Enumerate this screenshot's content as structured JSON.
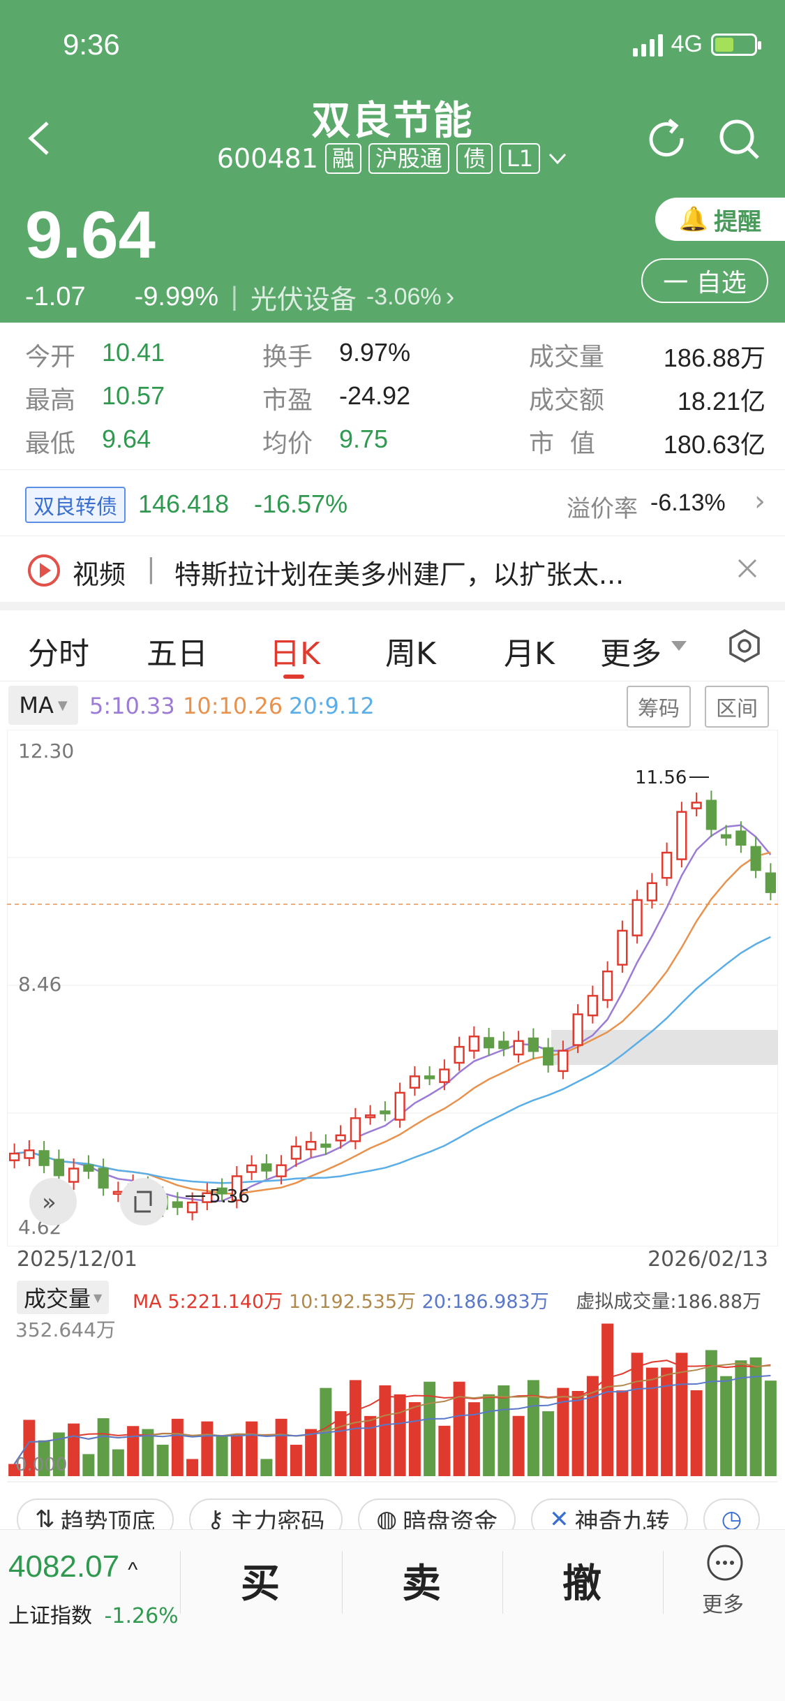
{
  "status": {
    "time": "9:36",
    "network": "4G"
  },
  "stock": {
    "name": "双良节能",
    "code": "600481",
    "tags": [
      "融",
      "沪股通",
      "债",
      "L1"
    ],
    "price": "9.64",
    "change": "-1.07",
    "change_pct": "-9.99%",
    "sector": "光伏设备",
    "sector_pct": "-3.06%",
    "remind": "提醒",
    "watch": "一 自选"
  },
  "stats": {
    "open_label": "今开",
    "open": "10.41",
    "high_label": "最高",
    "high": "10.57",
    "low_label": "最低",
    "low": "9.64",
    "turnover_label": "换手",
    "turnover": "9.97%",
    "pe_label": "市盈",
    "pe": "-24.92",
    "avg_label": "均价",
    "avg": "9.75",
    "vol_label": "成交量",
    "vol": "186.88万",
    "amount_label": "成交额",
    "amount": "18.21亿",
    "cap_label": "市  值",
    "cap": "180.63亿"
  },
  "bond": {
    "tag": "双良转债",
    "price": "146.418",
    "pct": "-16.57%",
    "premium_label": "溢价率",
    "premium": "-6.13%"
  },
  "news": {
    "tag": "视频",
    "text": "特斯拉计划在美多州建厂，以扩张太..."
  },
  "tabs": [
    "分时",
    "五日",
    "日K",
    "周K",
    "月K",
    "更多"
  ],
  "active_tab": "日K",
  "ma": {
    "label": "MA",
    "ma5": "5:10.33",
    "ma10": "10:10.26",
    "ma20": "20:9.12",
    "btn_chips": "筹码",
    "btn_range": "区间"
  },
  "kline": {
    "y_top": "12.30",
    "y_mid": "8.46",
    "y_bottom": "4.62",
    "date_start": "2025/12/01",
    "date_end": "2026/02/13",
    "max_label": "11.56",
    "min_label": "5.36"
  },
  "volume": {
    "label": "成交量",
    "ma_label": "MA",
    "ma5": "5:221.140万",
    "ma10": "10:192.535万",
    "ma20": "20:186.983万",
    "virtual": "虚拟成交量:186.88万",
    "top": "352.644万",
    "bottom": "0.000"
  },
  "chips": [
    "趋势顶底",
    "主力密码",
    "暗盘资金",
    "神奇九转"
  ],
  "bottom": {
    "index_value": "4082.07",
    "index_name": "上证指数",
    "index_pct": "-1.26%",
    "buy": "买",
    "sell": "卖",
    "cancel": "撤",
    "more": "更多"
  },
  "colors": {
    "up": "#e03a2f",
    "down": "#5f9e47",
    "header": "#5aa96b",
    "ma5": "#9b7bd6",
    "ma10": "#e8924e",
    "ma20": "#5aaee8"
  }
}
